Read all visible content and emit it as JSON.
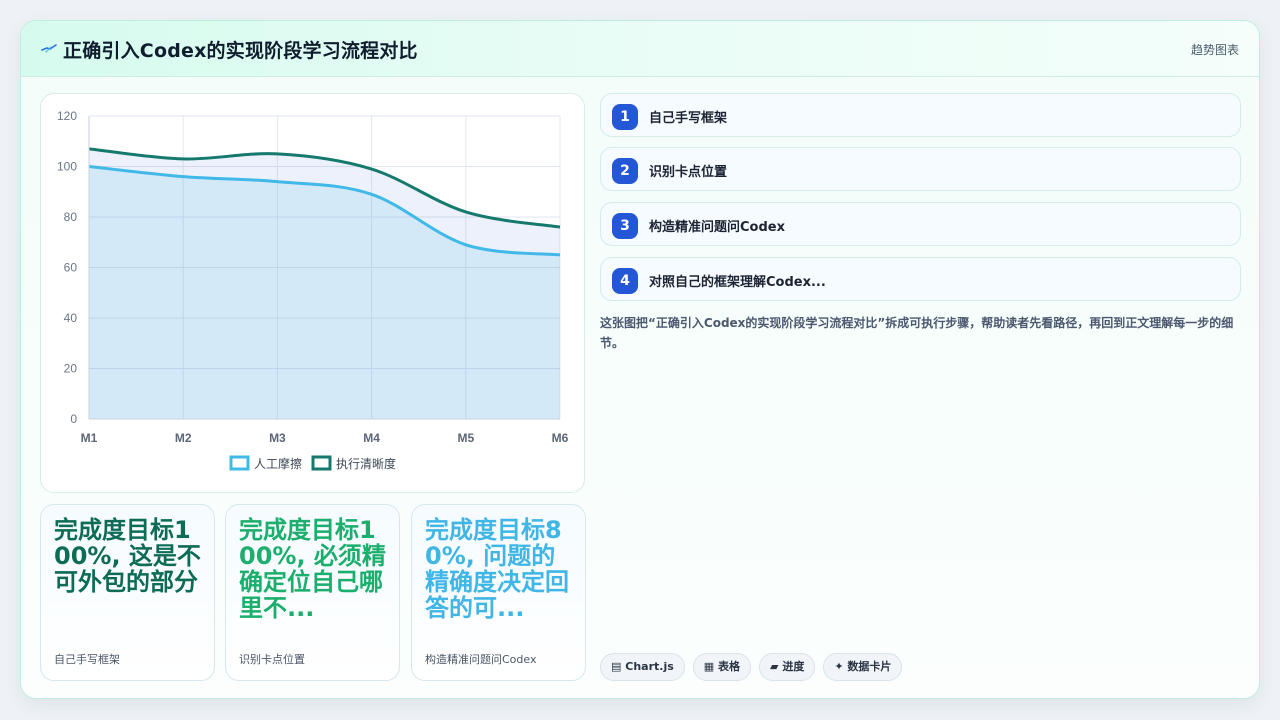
{
  "header": {
    "title": "正确引入Codex的实现阶段学习流程对比",
    "tag": "趋势图表"
  },
  "chart_data": {
    "type": "area",
    "categories": [
      "M1",
      "M2",
      "M3",
      "M4",
      "M5",
      "M6"
    ],
    "ylim": [
      0,
      120
    ],
    "yticks": [
      0,
      20,
      40,
      60,
      80,
      100,
      120
    ],
    "grid": true,
    "legend": "bottom",
    "series": [
      {
        "name": "人工摩擦",
        "values": [
          100,
          96,
          94,
          89,
          69,
          65
        ],
        "color": "#40b8e8"
      },
      {
        "name": "执行清晰度",
        "values": [
          107,
          103,
          105,
          99,
          82,
          76
        ],
        "color": "#16796d"
      }
    ]
  },
  "stats": [
    {
      "value": "完成度目标100%, 这是不可外包的部分",
      "label": "自己手写框架",
      "color": "#0d6b56"
    },
    {
      "value": "完成度目标100%, 必须精确定位自己哪里不...",
      "label": "识别卡点位置",
      "color": "#1cae6c"
    },
    {
      "value": "完成度目标80%, 问题的精确度决定回答的可...",
      "label": "构造精准问题问Codex",
      "color": "#3fb6e6"
    }
  ],
  "steps": [
    {
      "num": "1",
      "label": "自己手写框架"
    },
    {
      "num": "2",
      "label": "识别卡点位置"
    },
    {
      "num": "3",
      "label": "构造精准问题问Codex"
    },
    {
      "num": "4",
      "label": "对照自己的框架理解Codex..."
    }
  ],
  "description": "这张图把“正确引入Codex的实现阶段学习流程对比”拆成可执行步骤，帮助读者先看路径，再回到正文理解每一步的细节。",
  "chips": [
    {
      "icon": "chart-icon",
      "glyph": "▤",
      "label": "Chart.js"
    },
    {
      "icon": "table-icon",
      "glyph": "▦",
      "label": "表格"
    },
    {
      "icon": "progress-icon",
      "glyph": "▰",
      "label": "进度"
    },
    {
      "icon": "sparkle-icon",
      "glyph": "✦",
      "label": "数据卡片"
    }
  ],
  "colors": {
    "accent": "#2457d6",
    "border": "#bfeedd"
  }
}
